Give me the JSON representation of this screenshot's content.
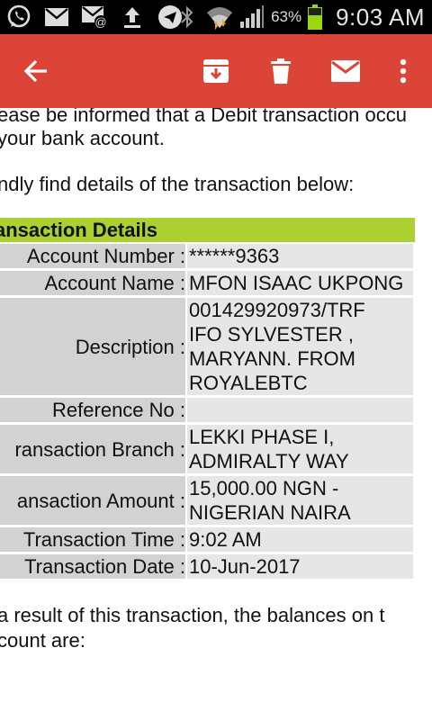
{
  "status_bar": {
    "battery": "63%",
    "time": "9:03 AM",
    "icons": [
      "whatsapp-icon",
      "email-icon",
      "email-at-icon",
      "upload-icon",
      "telegram-icon",
      "bluetooth-icon",
      "wifi-icon",
      "signal-icon",
      "battery-icon"
    ]
  },
  "app_bar": {
    "icons": [
      "back-arrow-icon",
      "archive-icon",
      "delete-icon",
      "mail-icon",
      "more-vert-icon"
    ],
    "color": "#db4437"
  },
  "email": {
    "intro_line1": "ease be informed that a Debit transaction occu",
    "intro_line2": " your bank account.",
    "find_line": "ndly find details of the transaction below:",
    "table_title": "ansaction Details",
    "rows": [
      {
        "label": "Account Number :",
        "value": "******9363"
      },
      {
        "label": "Account Name :",
        "value": "MFON ISAAC UKPONG"
      },
      {
        "label": "Description :",
        "value_lines": [
          "001429920973/TRF",
          "IFO SYLVESTER ,",
          "MARYANN. FROM",
          "ROYALEBTC"
        ]
      },
      {
        "label": "Reference No :",
        "value": ""
      },
      {
        "label": "ransaction Branch :",
        "value_lines": [
          "LEKKI PHASE I,",
          "ADMIRALTY WAY"
        ]
      },
      {
        "label": "ansaction Amount :",
        "value_lines": [
          "15,000.00 NGN -",
          "NIGERIAN NAIRA"
        ]
      },
      {
        "label": "Transaction Time :",
        "value": "9:02 AM"
      },
      {
        "label": "Transaction Date :",
        "value": "10-Jun-2017"
      }
    ],
    "outro_line1": " a result of this transaction, the balances on t",
    "outro_line2": "count are:"
  }
}
